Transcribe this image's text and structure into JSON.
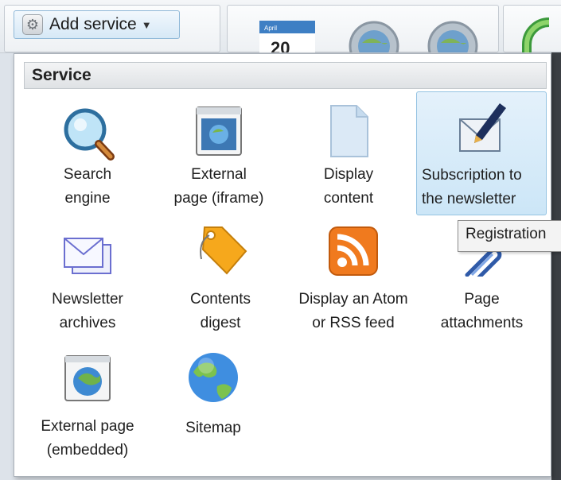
{
  "toolbar": {
    "add_service_label": "Add service",
    "calendar_month": "April",
    "calendar_day": "20"
  },
  "menu": {
    "header": "Service",
    "items": [
      {
        "line1": "Search",
        "line2": "engine",
        "icon": "magnifier-icon"
      },
      {
        "line1": "External",
        "line2": "page (iframe)",
        "icon": "browser-window-icon"
      },
      {
        "line1": "Display",
        "line2": "content",
        "icon": "document-icon"
      },
      {
        "line1": "Subscription to",
        "line2": "the newsletter",
        "icon": "envelope-pen-icon"
      },
      {
        "line1": "Newsletter",
        "line2": "archives",
        "icon": "envelopes-icon"
      },
      {
        "line1": "Contents",
        "line2": "digest",
        "icon": "tag-icon"
      },
      {
        "line1": "Display an Atom",
        "line2": "or RSS feed",
        "icon": "rss-icon"
      },
      {
        "line1": "Page",
        "line2": "attachments",
        "icon": "paperclip-icon"
      },
      {
        "line1": "External page",
        "line2": "(embedded)",
        "icon": "globe-window-icon"
      },
      {
        "line1": "Sitemap",
        "line2": "",
        "icon": "globe-icon"
      }
    ]
  },
  "tooltip": {
    "text": "Registration"
  },
  "colors": {
    "accent": "#94c3e2",
    "rss": "#f07a1e",
    "tag": "#f6a81c"
  }
}
